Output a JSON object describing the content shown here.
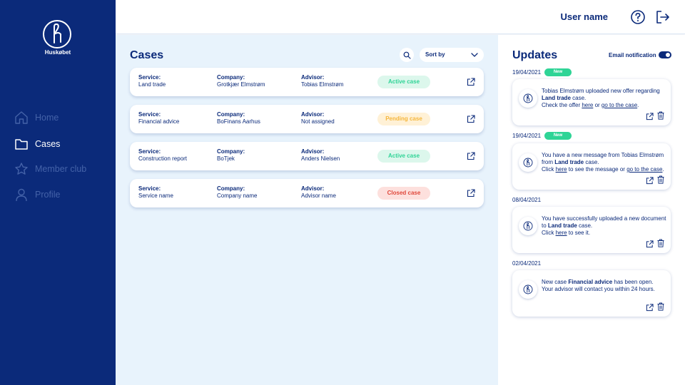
{
  "brand": {
    "name": "Huskøbet"
  },
  "header": {
    "username": "User name"
  },
  "sidebar": {
    "items": [
      {
        "label": "Home",
        "icon": "home-icon",
        "active": false
      },
      {
        "label": "Cases",
        "icon": "folder-icon",
        "active": true
      },
      {
        "label": "Member club",
        "icon": "star-icon",
        "active": false
      },
      {
        "label": "Profile",
        "icon": "user-icon",
        "active": false
      }
    ]
  },
  "cases": {
    "title": "Cases",
    "sort_label": "Sort by",
    "column_labels": {
      "service": "Service:",
      "company": "Company:",
      "advisor": "Advisor:"
    },
    "rows": [
      {
        "service": "Land trade",
        "company": "Grotkjær Elmstrøm",
        "advisor": "Tobias Elmstrøm",
        "status": "Active case"
      },
      {
        "service": "Financial advice",
        "company": "BoFinans Aarhus",
        "advisor": "Not assigned",
        "status": "Pending case"
      },
      {
        "service": "Construction report",
        "company": "BoTjek",
        "advisor": "Anders Nielsen",
        "status": "Active case"
      },
      {
        "service": "Service name",
        "company": "Company name",
        "advisor": "Advisor name",
        "status": "Closed case"
      }
    ]
  },
  "updates": {
    "title": "Updates",
    "email_notification_label": "Email notification",
    "new_label": "New",
    "items": [
      {
        "date": "19/04/2021",
        "is_new": true,
        "t1": "Tobias Elmstrøm uploaded new offer regarding ",
        "b1": "Land trade",
        "t2": " case.",
        "t3": "Check the offer ",
        "l1": "here",
        "t4": " or ",
        "l2": "go to the case",
        "t5": "."
      },
      {
        "date": "19/04/2021",
        "is_new": true,
        "t1": "You have a new message from Tobias Elmstrøm from ",
        "b1": "Land trade",
        "t2": " case.",
        "t3": "Click ",
        "l1": "here",
        "t4": " to see the message or ",
        "l2": "go to the case",
        "t5": "."
      },
      {
        "date": "08/04/2021",
        "is_new": false,
        "t1": "You have successfully uploaded a new document to ",
        "b1": "Land trade",
        "t2": " case.",
        "t3": "Click ",
        "l1": "here",
        "t4": " to see it.",
        "l2": "",
        "t5": ""
      },
      {
        "date": "02/04/2021",
        "is_new": false,
        "t1": "New case ",
        "b1": "Financial advice",
        "t2": " has been open.",
        "t3": "Your advisor will contact you within 24 hours.",
        "l1": "",
        "t4": "",
        "l2": "",
        "t5": ""
      }
    ]
  },
  "colors": {
    "primary": "#0b2a7a",
    "sidebar_inactive": "#4462a8",
    "cases_bg": "#e8f3fc",
    "active_bg": "#dcf7ec",
    "active_fg": "#2fd496",
    "pending_bg": "#fff1d6",
    "pending_fg": "#f5b63c",
    "closed_bg": "#fde0dd",
    "closed_fg": "#e0483b",
    "new_badge": "#2fd496"
  }
}
